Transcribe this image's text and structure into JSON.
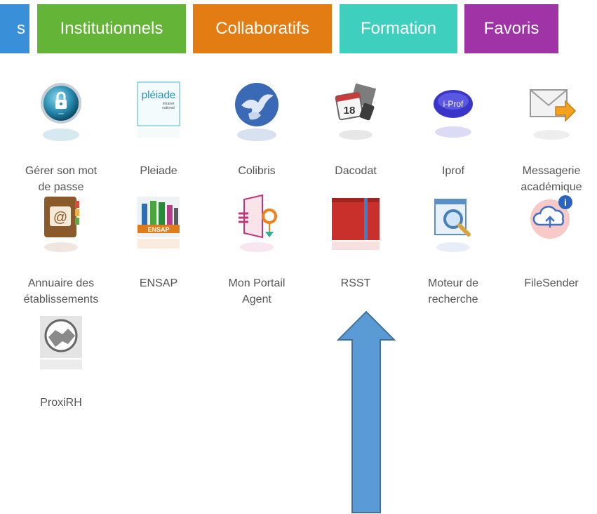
{
  "tabs": [
    {
      "label": "s",
      "color": "#3a8fd9"
    },
    {
      "label": "Institutionnels",
      "color": "#63b437"
    },
    {
      "label": "Collaboratifs",
      "color": "#e37d13"
    },
    {
      "label": "Formation",
      "color": "#3fcfbe"
    },
    {
      "label": "Favoris",
      "color": "#a033a6"
    }
  ],
  "apps": [
    {
      "line1": "Gérer son mot",
      "line2": "de passe",
      "icon": "lock-icon"
    },
    {
      "line1": "Pleiade",
      "line2": "",
      "icon": "pleiade-icon"
    },
    {
      "line1": "Colibris",
      "line2": "",
      "icon": "colibris-icon"
    },
    {
      "line1": "Dacodat",
      "line2": "",
      "icon": "dacodat-icon"
    },
    {
      "line1": "Iprof",
      "line2": "",
      "icon": "iprof-icon"
    },
    {
      "line1": "Messagerie",
      "line2": "académique",
      "icon": "mail-icon"
    },
    {
      "line1": "Annuaire des",
      "line2": "établissements",
      "icon": "address-book-icon"
    },
    {
      "line1": "ENSAP",
      "line2": "",
      "icon": "ensap-icon"
    },
    {
      "line1": "Mon Portail",
      "line2": "Agent",
      "icon": "portal-icon"
    },
    {
      "line1": "RSST",
      "line2": "",
      "icon": "rsst-book-icon"
    },
    {
      "line1": "Moteur de",
      "line2": "recherche",
      "icon": "search-engine-icon"
    },
    {
      "line1": "FileSender",
      "line2": "",
      "icon": "cloud-upload-icon"
    },
    {
      "line1": "ProxiRH",
      "line2": "",
      "icon": "handshake-icon"
    }
  ],
  "icon_texts": {
    "pleiade_logo": "pléiade",
    "pleiade_sub1": "intranet",
    "pleiade_sub2": "national",
    "iprof_logo": "i-Prof",
    "ensap_logo": "ENSAP",
    "dacodat_date": "18",
    "filesender_badge": "i"
  },
  "annotation": {
    "type": "arrow-up",
    "color": "#5b9bd5",
    "stroke": "#41719c"
  }
}
